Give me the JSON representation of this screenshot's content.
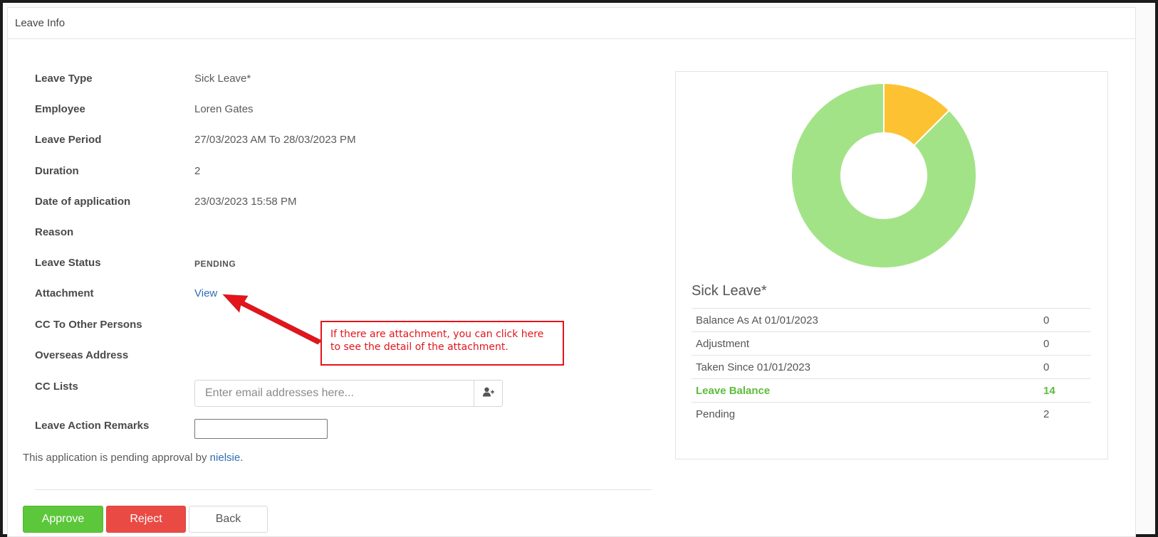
{
  "panel": {
    "heading": "Leave Info"
  },
  "details": [
    {
      "label": "Leave Type",
      "value": "Sick Leave*"
    },
    {
      "label": "Employee",
      "value": "Loren Gates"
    },
    {
      "label": "Leave Period",
      "value": "27/03/2023 AM To 28/03/2023 PM"
    },
    {
      "label": "Duration",
      "value": "2"
    },
    {
      "label": "Date of application",
      "value": "23/03/2023 15:58 PM"
    },
    {
      "label": "Reason",
      "value": ""
    },
    {
      "label": "Leave Status",
      "value": "PENDING"
    },
    {
      "label": "Attachment",
      "value": "View"
    },
    {
      "label": "CC To Other Persons",
      "value": ""
    },
    {
      "label": "Overseas Address",
      "value": ""
    },
    {
      "label": "CC Lists",
      "value": ""
    },
    {
      "label": "Leave Action Remarks",
      "value": ""
    }
  ],
  "cc_input": {
    "placeholder": "Enter email addresses here...",
    "icon": "add-user-icon"
  },
  "pending_note": {
    "prefix": "This application is pending approval by ",
    "approver": "nielsie",
    "suffix": "."
  },
  "buttons": {
    "approve": "Approve",
    "reject": "Reject",
    "back": "Back"
  },
  "callout": {
    "text": "If there are attachment, you can click here to see the detail of the attachment."
  },
  "colors": {
    "approve": "#5cc73a",
    "reject": "#e94b44",
    "link": "#2f6db5",
    "callout": "#e3141b",
    "donut_green": "#a3e388",
    "donut_yellow": "#fcc232",
    "highlight": "#5cbd3a"
  },
  "balance": {
    "title": "Sick Leave*",
    "rows": [
      {
        "label": "Balance As At 01/01/2023",
        "value": "0"
      },
      {
        "label": "Adjustment",
        "value": "0"
      },
      {
        "label": "Taken Since 01/01/2023",
        "value": "0"
      },
      {
        "label": "Leave Balance",
        "value": "14"
      },
      {
        "label": "Pending",
        "value": "2"
      }
    ]
  },
  "chart_data": {
    "type": "pie",
    "variant": "donut",
    "title": "",
    "labels": [
      "Pending",
      "Leave Balance"
    ],
    "values": [
      2,
      14
    ],
    "colors": [
      "#fcc232",
      "#a3e388"
    ]
  }
}
